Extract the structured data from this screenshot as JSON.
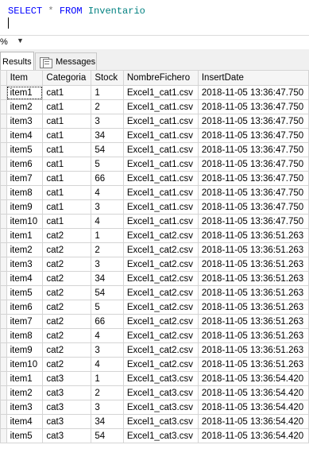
{
  "editor": {
    "kw_select": "SELECT",
    "star": "*",
    "kw_from": "FROM",
    "table_name": "Inventario"
  },
  "zoom": {
    "value": "%",
    "arrow": "▼"
  },
  "tabs": {
    "results": "Results",
    "messages": "Messages"
  },
  "grid": {
    "columns": [
      "Item",
      "Categoria",
      "Stock",
      "NombreFichero",
      "InsertDate"
    ],
    "rows": [
      [
        "item1",
        "cat1",
        "1",
        "Excel1_cat1.csv",
        "2018-11-05 13:36:47.750"
      ],
      [
        "item2",
        "cat1",
        "2",
        "Excel1_cat1.csv",
        "2018-11-05 13:36:47.750"
      ],
      [
        "item3",
        "cat1",
        "3",
        "Excel1_cat1.csv",
        "2018-11-05 13:36:47.750"
      ],
      [
        "item4",
        "cat1",
        "34",
        "Excel1_cat1.csv",
        "2018-11-05 13:36:47.750"
      ],
      [
        "item5",
        "cat1",
        "54",
        "Excel1_cat1.csv",
        "2018-11-05 13:36:47.750"
      ],
      [
        "item6",
        "cat1",
        "5",
        "Excel1_cat1.csv",
        "2018-11-05 13:36:47.750"
      ],
      [
        "item7",
        "cat1",
        "66",
        "Excel1_cat1.csv",
        "2018-11-05 13:36:47.750"
      ],
      [
        "item8",
        "cat1",
        "4",
        "Excel1_cat1.csv",
        "2018-11-05 13:36:47.750"
      ],
      [
        "item9",
        "cat1",
        "3",
        "Excel1_cat1.csv",
        "2018-11-05 13:36:47.750"
      ],
      [
        "item10",
        "cat1",
        "4",
        "Excel1_cat1.csv",
        "2018-11-05 13:36:47.750"
      ],
      [
        "item1",
        "cat2",
        "1",
        "Excel1_cat2.csv",
        "2018-11-05 13:36:51.263"
      ],
      [
        "item2",
        "cat2",
        "2",
        "Excel1_cat2.csv",
        "2018-11-05 13:36:51.263"
      ],
      [
        "item3",
        "cat2",
        "3",
        "Excel1_cat2.csv",
        "2018-11-05 13:36:51.263"
      ],
      [
        "item4",
        "cat2",
        "34",
        "Excel1_cat2.csv",
        "2018-11-05 13:36:51.263"
      ],
      [
        "item5",
        "cat2",
        "54",
        "Excel1_cat2.csv",
        "2018-11-05 13:36:51.263"
      ],
      [
        "item6",
        "cat2",
        "5",
        "Excel1_cat2.csv",
        "2018-11-05 13:36:51.263"
      ],
      [
        "item7",
        "cat2",
        "66",
        "Excel1_cat2.csv",
        "2018-11-05 13:36:51.263"
      ],
      [
        "item8",
        "cat2",
        "4",
        "Excel1_cat2.csv",
        "2018-11-05 13:36:51.263"
      ],
      [
        "item9",
        "cat2",
        "3",
        "Excel1_cat2.csv",
        "2018-11-05 13:36:51.263"
      ],
      [
        "item10",
        "cat2",
        "4",
        "Excel1_cat2.csv",
        "2018-11-05 13:36:51.263"
      ],
      [
        "item1",
        "cat3",
        "1",
        "Excel1_cat3.csv",
        "2018-11-05 13:36:54.420"
      ],
      [
        "item2",
        "cat3",
        "2",
        "Excel1_cat3.csv",
        "2018-11-05 13:36:54.420"
      ],
      [
        "item3",
        "cat3",
        "3",
        "Excel1_cat3.csv",
        "2018-11-05 13:36:54.420"
      ],
      [
        "item4",
        "cat3",
        "34",
        "Excel1_cat3.csv",
        "2018-11-05 13:36:54.420"
      ],
      [
        "item5",
        "cat3",
        "54",
        "Excel1_cat3.csv",
        "2018-11-05 13:36:54.420"
      ]
    ]
  }
}
